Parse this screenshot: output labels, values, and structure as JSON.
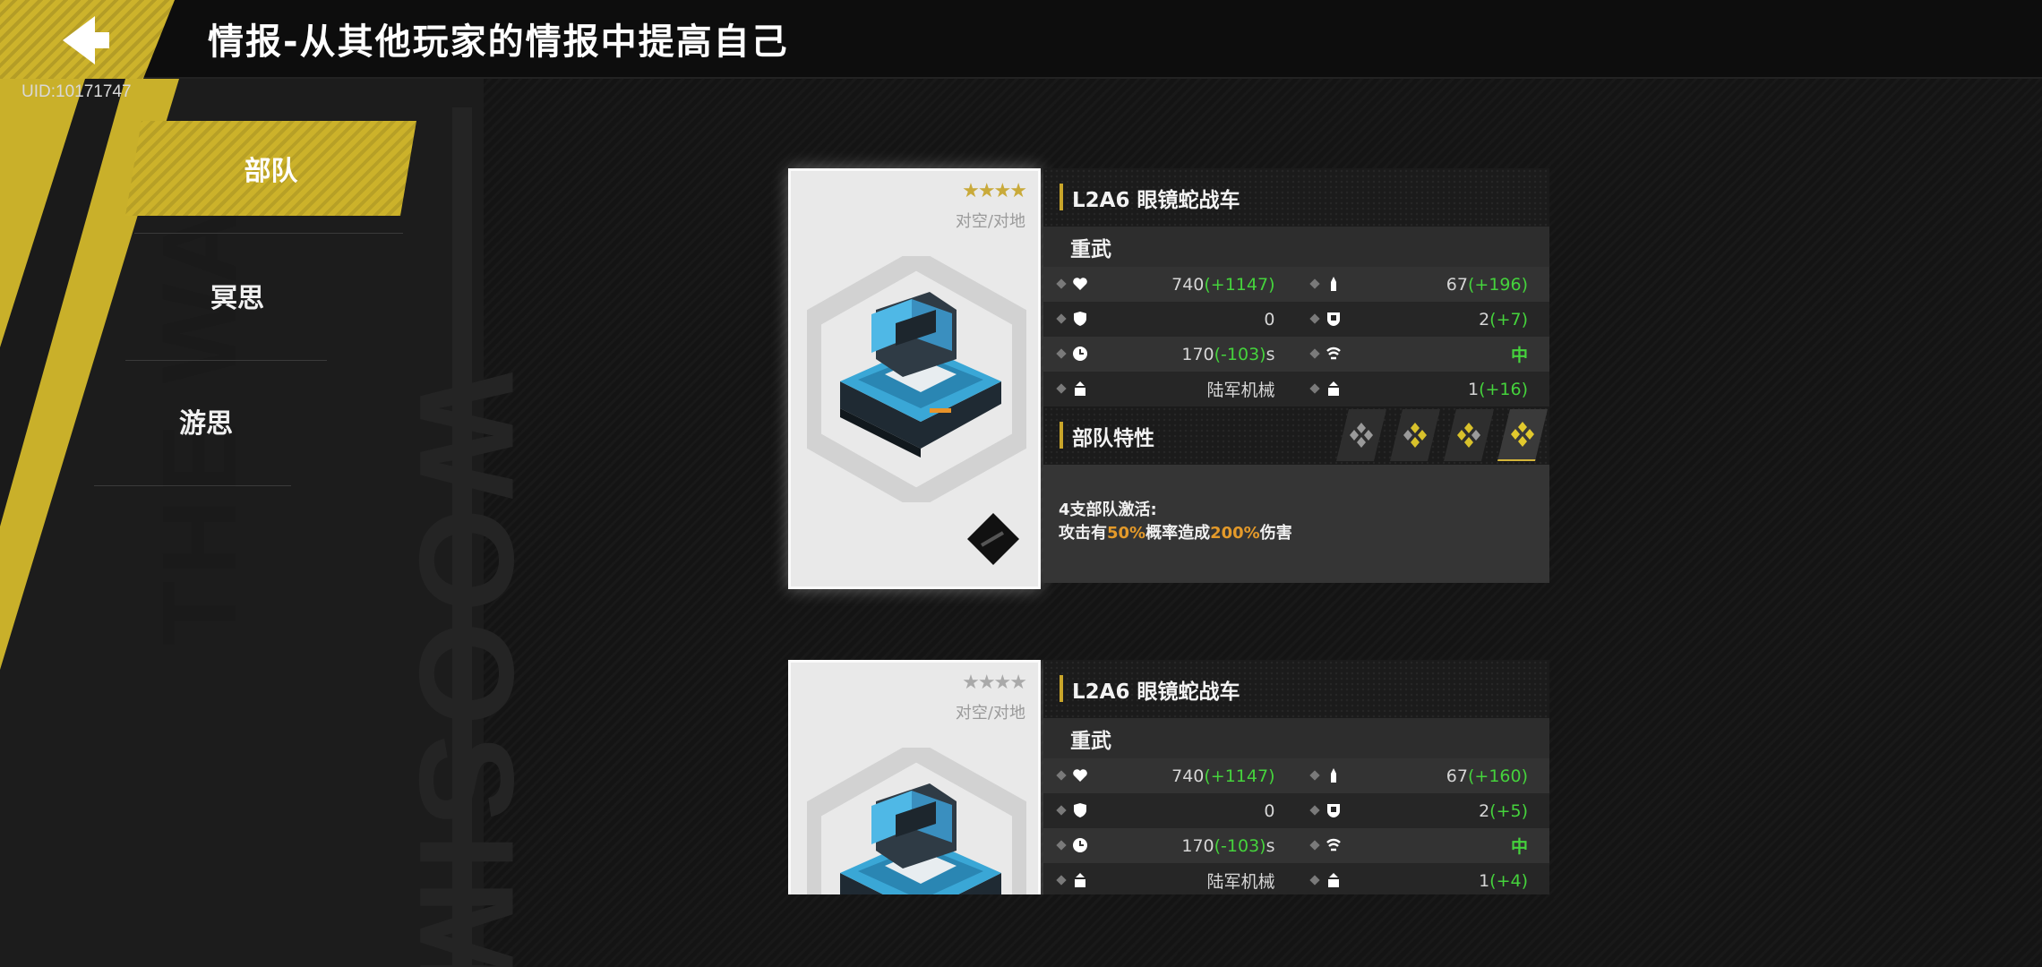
{
  "header": {
    "title": "情报-从其他玩家的情报中提高自己",
    "uid": "UID:10171747"
  },
  "sidebar": {
    "tabs": [
      {
        "label": "部队",
        "active": true
      },
      {
        "label": "冥思",
        "active": false
      },
      {
        "label": "游思",
        "active": false
      }
    ],
    "deco_left": "THE WAR",
    "deco_right": "WOOSIM"
  },
  "colors": {
    "accent": "#ccb22a",
    "bonus": "#45d33c",
    "highlight": "#e49a2a"
  },
  "cards": [
    {
      "stars": "★★★★",
      "star_color": "#c9aa3a",
      "type": "对空/对地",
      "name": "L2A6 眼镜蛇战车",
      "class": "重武",
      "stats": [
        {
          "left": {
            "icon": "heart-icon",
            "value": "740",
            "bonus": "(+1147)"
          },
          "right": {
            "icon": "ammo-icon",
            "value": "67",
            "bonus": "(+196)"
          }
        },
        {
          "left": {
            "icon": "shield-icon",
            "value": "0",
            "bonus": ""
          },
          "right": {
            "icon": "armor-icon",
            "value": "2",
            "bonus": "(+7)"
          }
        },
        {
          "left": {
            "icon": "clock-icon",
            "value": "170",
            "bonus": "(-103)",
            "suffix": "s"
          },
          "right": {
            "icon": "speed-icon",
            "value": "",
            "bonus": "中"
          }
        },
        {
          "left": {
            "icon": "unit-type-icon",
            "value": "陆军机械",
            "bonus": ""
          },
          "right": {
            "icon": "unit-count-icon",
            "value": "1",
            "bonus": "(+16)"
          }
        }
      ],
      "trait_title": "部队特性",
      "trait_line1": "4支部队激活:",
      "trait_pre": "攻击有",
      "trait_pct1": "50%",
      "trait_mid": "概率造成",
      "trait_pct2": "200%",
      "trait_post": "伤害"
    },
    {
      "stars": "★★★★",
      "star_color": "#a9a9a9",
      "type": "对空/对地",
      "name": "L2A6 眼镜蛇战车",
      "class": "重武",
      "stats": [
        {
          "left": {
            "icon": "heart-icon",
            "value": "740",
            "bonus": "(+1147)"
          },
          "right": {
            "icon": "ammo-icon",
            "value": "67",
            "bonus": "(+160)"
          }
        },
        {
          "left": {
            "icon": "shield-icon",
            "value": "0",
            "bonus": ""
          },
          "right": {
            "icon": "armor-icon",
            "value": "2",
            "bonus": "(+5)"
          }
        },
        {
          "left": {
            "icon": "clock-icon",
            "value": "170",
            "bonus": "(-103)",
            "suffix": "s"
          },
          "right": {
            "icon": "speed-icon",
            "value": "",
            "bonus": "中"
          }
        },
        {
          "left": {
            "icon": "unit-type-icon",
            "value": "陆军机械",
            "bonus": ""
          },
          "right": {
            "icon": "unit-count-icon",
            "value": "1",
            "bonus": "(+4)"
          }
        }
      ]
    }
  ]
}
